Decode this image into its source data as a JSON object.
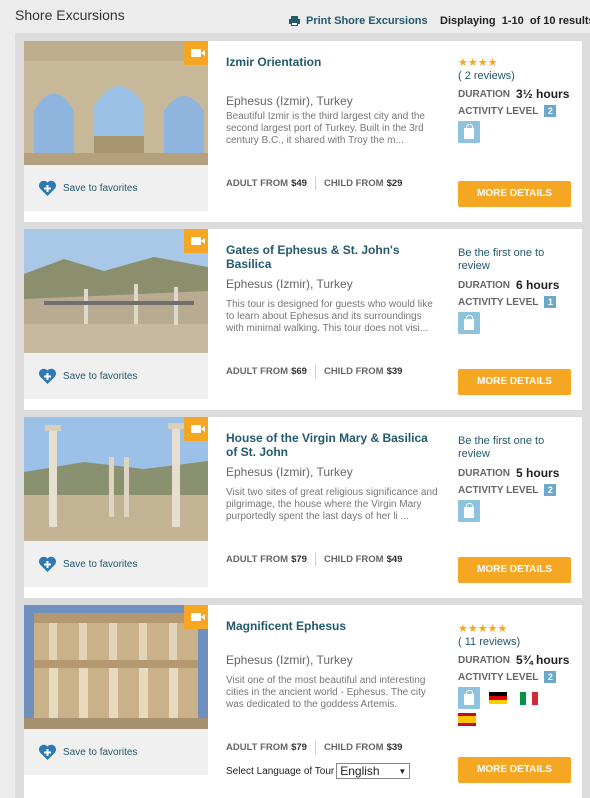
{
  "header": {
    "title": "Shore Excursions",
    "print_label": "Print Shore Excursions",
    "displaying": "Displaying  1-10  of 10 results"
  },
  "common": {
    "save_to_favorites": "Save to favorites",
    "adult_from": "ADULT FROM",
    "child_from": "CHILD FROM",
    "duration_label": "DURATION",
    "activity_label": "ACTIVITY LEVEL",
    "more_details": "MORE DETAILS",
    "first_review": "Be the first one to review",
    "select_language": "Select Language of Tour",
    "language_selected": "English"
  },
  "colors": {
    "accent": "#f5a623",
    "link": "#235a6e",
    "level": "#6aa9cd"
  },
  "excursions": [
    {
      "title": "Izmir Orientation",
      "location": "Ephesus (Izmir), Turkey",
      "description": "Beautiful Izmir is the third largest city and the second largest port of Turkey. Built in the 3rd century B.C., it shared with Troy the m...",
      "adult_price": "$49",
      "child_price": "$29",
      "rating_stars": 4,
      "stars_text": "★★★★",
      "reviews": "( 2 reviews)",
      "duration": "3½ hours",
      "activity_level": "2"
    },
    {
      "title": "Gates of Ephesus & St. John's Basilica",
      "location": "Ephesus (Izmir), Turkey",
      "description": "This tour is designed for guests who would like to learn about Ephesus and its surroundings with minimal walking. This tour does not visi...",
      "adult_price": "$69",
      "child_price": "$39",
      "duration": "6 hours",
      "activity_level": "1"
    },
    {
      "title": "House of the Virgin Mary & Basilica of St. John",
      "location": "Ephesus (Izmir), Turkey",
      "description": "Visit two sites of great religious significance and pilgrimage, the house where the Virgin Mary purportedly spent the last days of her li ...",
      "adult_price": "$79",
      "child_price": "$49",
      "duration": "5 hours",
      "activity_level": "2"
    },
    {
      "title": "Magnificent Ephesus",
      "location": "Ephesus (Izmir), Turkey",
      "description": "Visit one of the most beautiful and interesting cities in the ancient world - Ephesus. The city was dedicated to the goddess Artemis.",
      "adult_price": "$79",
      "child_price": "$39",
      "rating_stars": 5,
      "stars_text": "★★★★★",
      "reviews": "( 11 reviews)",
      "duration": "5¾ hours",
      "activity_level": "2",
      "language_flags": [
        "german-flag-icon",
        "italian-flag-icon",
        "spanish-flag-icon"
      ]
    }
  ]
}
